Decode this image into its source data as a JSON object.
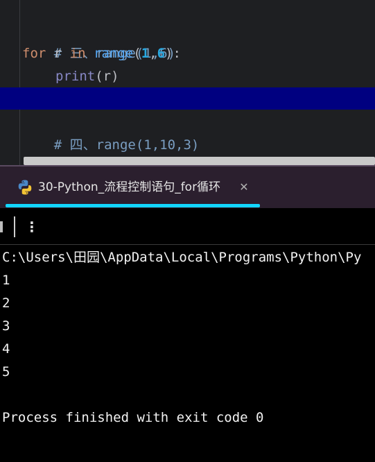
{
  "editor": {
    "lines": {
      "l1": {
        "comment": "# 三、range(1,6)"
      },
      "l2": {
        "kw_for": "for",
        "var": "r",
        "kw_in": "in",
        "fn": "range",
        "paren_open": "(",
        "num1": "1",
        "comma": ",",
        "num2": "6",
        "paren_close": "):"
      },
      "l3": {
        "fn": "print",
        "args": "(r)"
      },
      "l5": {
        "comment": "# 四、range(1,10,3)"
      }
    }
  },
  "run_tab": {
    "icon": "python-icon",
    "label": "30-Python_流程控制语句_for循环",
    "close": "✕"
  },
  "toolbar": {
    "more": "⋮"
  },
  "console": {
    "command": "C:\\Users\\田园\\AppData\\Local\\Programs\\Python\\Py",
    "outputs": [
      "1",
      "2",
      "3",
      "4",
      "5"
    ],
    "exit_message": "Process finished with exit code 0"
  },
  "colors": {
    "editor_bg": "#1e1f22",
    "current_line": "#000080",
    "tab_accent": "#12d6ff",
    "console_bg": "#000000"
  }
}
